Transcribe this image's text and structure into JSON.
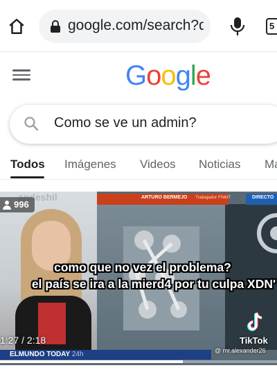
{
  "browser": {
    "url": "google.com/search?q",
    "tab_count": "5"
  },
  "google": {
    "logo_letters": [
      {
        "ch": "G",
        "color": "#4285F4"
      },
      {
        "ch": "o",
        "color": "#EA4335"
      },
      {
        "ch": "o",
        "color": "#FBBC05"
      },
      {
        "ch": "g",
        "color": "#4285F4"
      },
      {
        "ch": "l",
        "color": "#34A853"
      },
      {
        "ch": "e",
        "color": "#EA4335"
      }
    ]
  },
  "search": {
    "query": "Como se ve un admin?"
  },
  "tabs": [
    {
      "label": "Todos",
      "active": true
    },
    {
      "label": "Imágenes",
      "active": false
    },
    {
      "label": "Videos",
      "active": false
    },
    {
      "label": "Noticias",
      "active": false
    },
    {
      "label": "Ma",
      "active": false
    }
  ],
  "video": {
    "source_label": "andeshil",
    "viewers": "996",
    "lower_third_name": "ARTURO BERMEJO",
    "lower_third_role": "Trabajador FNMT",
    "lower_third_tag": "DIRECTO",
    "caption_line1": "como que no vez el problema?",
    "caption_line2": "el país se ira a la mierd4 por tu culpa XDN'",
    "time": "1:27 / 2:18",
    "progress": 0.66,
    "ticker_brand": "ELMUNDO TODAY",
    "ticker_sub": "24h",
    "tiktok_label": "TikTok",
    "tiktok_user": "@ mr.alexander26"
  }
}
